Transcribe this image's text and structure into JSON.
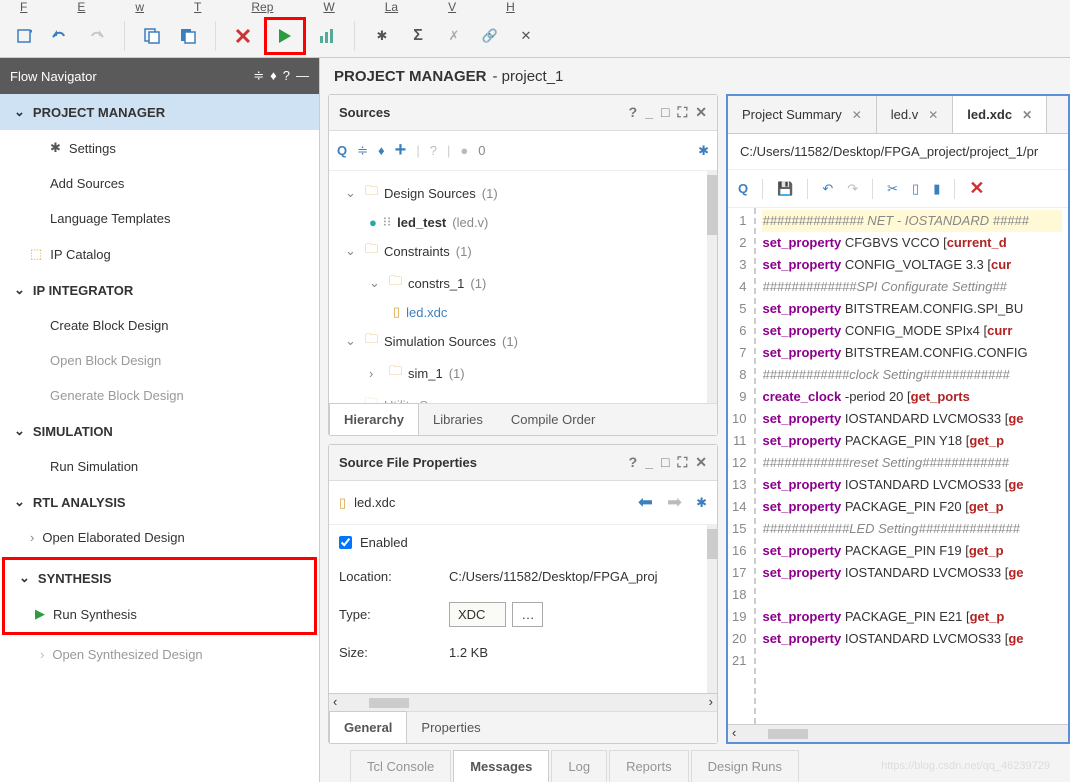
{
  "menu": [
    "File",
    "Edit",
    "Flow",
    "Tools",
    "Reports",
    "Window",
    "Layout",
    "View",
    "Help"
  ],
  "flownav": {
    "title": "Flow Navigator",
    "pm": {
      "header": "PROJECT MANAGER",
      "items": [
        "Settings",
        "Add Sources",
        "Language Templates",
        "IP Catalog"
      ]
    },
    "ipi": {
      "header": "IP INTEGRATOR",
      "items": [
        "Create Block Design",
        "Open Block Design",
        "Generate Block Design"
      ]
    },
    "sim": {
      "header": "SIMULATION",
      "items": [
        "Run Simulation"
      ]
    },
    "rtl": {
      "header": "RTL ANALYSIS",
      "items": [
        "Open Elaborated Design"
      ]
    },
    "syn": {
      "header": "SYNTHESIS",
      "items": [
        "Run Synthesis",
        "Open Synthesized Design"
      ]
    }
  },
  "pm_header": {
    "bold": "PROJECT MANAGER",
    "rest": " - project_1"
  },
  "sources": {
    "title": "Sources",
    "zero": "0",
    "tree": {
      "design": {
        "label": "Design Sources",
        "count": "(1)",
        "child": {
          "name": "led_test",
          "file": "(led.v)"
        }
      },
      "constraints": {
        "label": "Constraints",
        "count": "(1)",
        "child": {
          "name": "constrs_1",
          "count": "(1)",
          "file": "led.xdc"
        }
      },
      "sim": {
        "label": "Simulation Sources",
        "count": "(1)",
        "child": {
          "name": "sim_1",
          "count": "(1)"
        }
      },
      "util": {
        "label": "Utility Sources"
      }
    },
    "tabs": [
      "Hierarchy",
      "Libraries",
      "Compile Order"
    ]
  },
  "props": {
    "title": "Source File Properties",
    "file": "led.xdc",
    "enabled": "Enabled",
    "loc_label": "Location:",
    "loc_val": "C:/Users/11582/Desktop/FPGA_proj",
    "type_label": "Type:",
    "type_val": "XDC",
    "size_label": "Size:",
    "size_val": "1.2 KB",
    "tabs": [
      "General",
      "Properties"
    ]
  },
  "editor": {
    "tabs": [
      {
        "label": "Project Summary"
      },
      {
        "label": "led.v"
      },
      {
        "label": "led.xdc"
      }
    ],
    "path": "C:/Users/11582/Desktop/FPGA_project/project_1/pr",
    "lines": [
      {
        "t": "cmhl",
        "v": "############## NET - IOSTANDARD #####"
      },
      {
        "t": "sp",
        "a": "set_property",
        "b": " CFGBVS VCCO [",
        "c": "current_d"
      },
      {
        "t": "sp",
        "a": "set_property",
        "b": " CONFIG_VOLTAGE 3.3 [",
        "c": "cur"
      },
      {
        "t": "cm",
        "v": "#############SPI Configurate Setting##"
      },
      {
        "t": "sp",
        "a": "set_property",
        "b": " BITSTREAM.CONFIG.SPI_BU"
      },
      {
        "t": "sp",
        "a": "set_property",
        "b": " CONFIG_MODE SPIx4 [",
        "c": "curr"
      },
      {
        "t": "sp",
        "a": "set_property",
        "b": " BITSTREAM.CONFIG.CONFIG"
      },
      {
        "t": "cm",
        "v": "############clock Setting############"
      },
      {
        "t": "sp",
        "a": "create_clock",
        "b": " -period 20 [",
        "c": "get_ports"
      },
      {
        "t": "sp",
        "a": "set_property",
        "b": " IOSTANDARD LVCMOS33 [",
        "c": "ge"
      },
      {
        "t": "sp",
        "a": "set_property",
        "b": " PACKAGE_PIN Y18 [",
        "c": "get_p"
      },
      {
        "t": "cm",
        "v": "############reset Setting############"
      },
      {
        "t": "sp",
        "a": "set_property",
        "b": " IOSTANDARD LVCMOS33 [",
        "c": "ge"
      },
      {
        "t": "sp",
        "a": "set_property",
        "b": " PACKAGE_PIN F20 [",
        "c": "get_p"
      },
      {
        "t": "cm",
        "v": "############LED Setting##############"
      },
      {
        "t": "sp",
        "a": "set_property",
        "b": " PACKAGE_PIN F19 [",
        "c": "get_p"
      },
      {
        "t": "sp",
        "a": "set_property",
        "b": " IOSTANDARD LVCMOS33 [",
        "c": "ge"
      },
      {
        "t": "blank",
        "v": ""
      },
      {
        "t": "sp",
        "a": "set_property",
        "b": " PACKAGE_PIN E21 [",
        "c": "get_p"
      },
      {
        "t": "sp",
        "a": "set_property",
        "b": " IOSTANDARD LVCMOS33 [",
        "c": "ge"
      },
      {
        "t": "blank",
        "v": ""
      }
    ]
  },
  "bottom_tabs": [
    "Tcl Console",
    "Messages",
    "Log",
    "Reports",
    "Design Runs"
  ],
  "watermark": "https://blog.csdn.net/qq_46239729"
}
